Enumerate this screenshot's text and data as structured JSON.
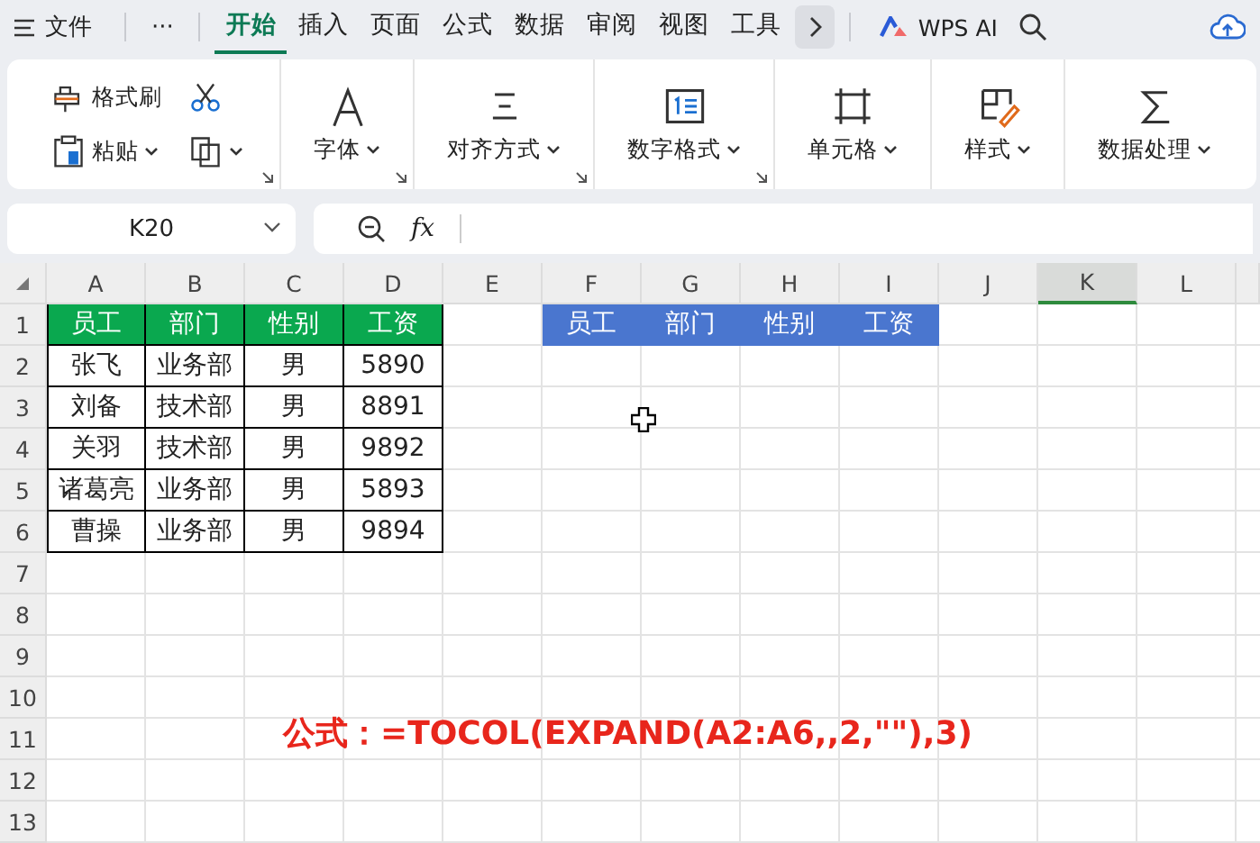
{
  "menu_bar": {
    "file_label": "文件",
    "more_label": "···",
    "tabs": [
      {
        "label": "开始",
        "selected": true
      },
      {
        "label": "插入",
        "selected": false
      },
      {
        "label": "页面",
        "selected": false
      },
      {
        "label": "公式",
        "selected": false
      },
      {
        "label": "数据",
        "selected": false
      },
      {
        "label": "审阅",
        "selected": false
      },
      {
        "label": "视图",
        "selected": false
      },
      {
        "label": "工具",
        "selected": false
      }
    ],
    "ai_label": "WPS AI"
  },
  "ribbon": {
    "groups": [
      {
        "kind": "clipboard",
        "launcher": true,
        "buttons": [
          {
            "label": "格式刷",
            "dropdown": false
          },
          {
            "dropdown": false
          },
          {
            "label": "粘贴",
            "dropdown": true
          },
          {
            "dropdown": true
          }
        ]
      },
      {
        "kind": "large",
        "label": "字体",
        "dropdown": true,
        "launcher": true
      },
      {
        "kind": "large",
        "label": "对齐方式",
        "dropdown": true,
        "launcher": true
      },
      {
        "kind": "large",
        "label": "数字格式",
        "dropdown": true,
        "launcher": true
      },
      {
        "kind": "large",
        "label": "单元格",
        "dropdown": true,
        "launcher": false
      },
      {
        "kind": "large",
        "label": "样式",
        "dropdown": true,
        "launcher": false
      },
      {
        "kind": "large",
        "label": "数据处理",
        "dropdown": true,
        "launcher": false
      }
    ]
  },
  "formula_bar": {
    "cell_reference": "K20",
    "function_label": "fx"
  },
  "sheet": {
    "columns": [
      {
        "label": "A",
        "selected": false
      },
      {
        "label": "B",
        "selected": false
      },
      {
        "label": "C",
        "selected": false
      },
      {
        "label": "D",
        "selected": false
      },
      {
        "label": "E",
        "selected": false
      },
      {
        "label": "F",
        "selected": false
      },
      {
        "label": "G",
        "selected": false
      },
      {
        "label": "H",
        "selected": false
      },
      {
        "label": "I",
        "selected": false
      },
      {
        "label": "J",
        "selected": false
      },
      {
        "label": "K",
        "selected": true
      },
      {
        "label": "L",
        "selected": false
      }
    ],
    "row_numbers": [
      "1",
      "2",
      "3",
      "4",
      "5",
      "6",
      "7",
      "8",
      "9",
      "10",
      "11",
      "12",
      "13"
    ],
    "source_table": {
      "headers": [
        "员工",
        "部门",
        "性别",
        "工资"
      ],
      "rows": [
        [
          "张飞",
          "业务部",
          "男",
          "5890"
        ],
        [
          "刘备",
          "技术部",
          "男",
          "8891"
        ],
        [
          "关羽",
          "技术部",
          "男",
          "9892"
        ],
        [
          "诸葛亮",
          "业务部",
          "男",
          "5893"
        ],
        [
          "曹操",
          "业务部",
          "男",
          "9894"
        ]
      ]
    },
    "result_header": [
      "员工",
      "部门",
      "性别",
      "工资"
    ]
  },
  "annotation": "公式：=TOCOL(EXPAND(A2:A6,,2,\"\"),3)"
}
